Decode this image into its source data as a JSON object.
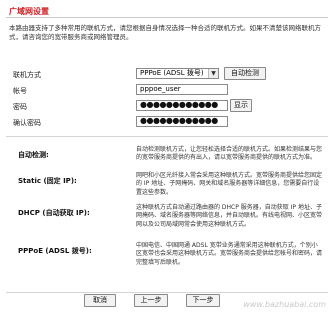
{
  "page": {
    "title": "广域网设置",
    "intro": "本路由器支持了多种常用的联机方式，请您根据自身情况选择一种合适的联机方式。如果不清楚该网络联机方式，请咨询您的宽带服务商或网络管理员。"
  },
  "form": {
    "connection_type_label": "联机方式",
    "connection_type_value": "PPPoE (ADSL 拨号)",
    "auto_detect_label": "自动检测",
    "account_label": "帐号",
    "account_value": "pppoe_user",
    "password_label": "密码",
    "password_value": "●●●●●●●●●●●●",
    "show_label": "显示",
    "confirm_password_label": "确认密码",
    "confirm_password_value": "●●●●●●●●●●●●"
  },
  "modes": [
    {
      "label": "自动检测:",
      "desc": "自动检测联机方式，让您轻松选择合适的联机方式。如果检测结果与您的宽带服务商提供的有出入，请以宽带服务商提供的联机方式为准。"
    },
    {
      "label": "Static (固定 IP):",
      "desc": "网吧和小区光纤接入常会采用这种联机方式。宽带服务商提供给您固定的 IP 地址、子网掩码、网关和域名服务器等详细信息，您需要自行设置这些参数。"
    },
    {
      "label": "DHCP (自动获取 IP):",
      "desc": "这种联机方式自动通过路由器的 DHCP 服务器，自动获取 IP 地址、子网掩码、域名服务器等网络信息，并自动联机。有线电视网、小区宽带网以及公司局域网常会使用这种联机方式。"
    },
    {
      "label": "PPPoE (ADSL 拨号):",
      "desc": "中国电信、中国网通 ADSL 宽带业务通常采用这种联机方式，个别小区宽带也会采用这种联机方式。宽带服务商会提供给您帐号和密码，请完整填写后联机。"
    }
  ],
  "buttons": {
    "cancel": "取消",
    "prev": "上一步",
    "next": "下一步"
  },
  "watermark": "www.bazhuabai.com"
}
